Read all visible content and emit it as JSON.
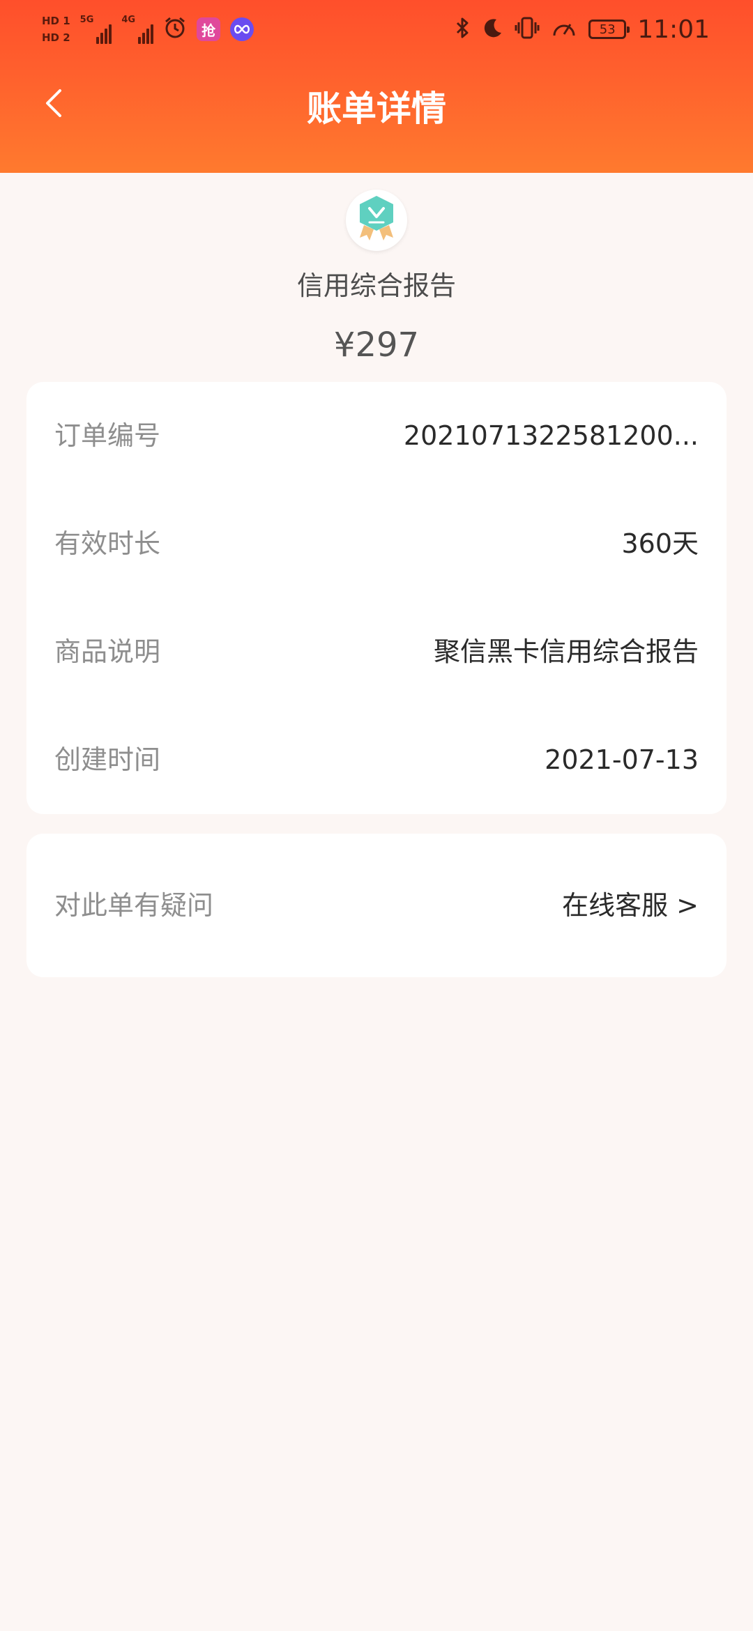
{
  "status_bar": {
    "hd1": "HD 1",
    "hd2": "HD 2",
    "net1": "5G",
    "net2": "4G",
    "app_badge_text": "抢",
    "battery": "53",
    "time": "11:01"
  },
  "header": {
    "title": "账单详情"
  },
  "product": {
    "name": "信用综合报告",
    "price": "¥297"
  },
  "details": [
    {
      "label": "订单编号",
      "value": "2021071322581200..."
    },
    {
      "label": "有效时长",
      "value": "360天"
    },
    {
      "label": "商品说明",
      "value": "聚信黑卡信用综合报告"
    },
    {
      "label": "创建时间",
      "value": "2021-07-13"
    }
  ],
  "support": {
    "label": "对此单有疑问",
    "link": "在线客服 >"
  },
  "colors": {
    "header_gradient_top": "#ff4f2b",
    "header_gradient_bottom": "#ff7a2e",
    "background": "#fcf6f4",
    "badge_teal": "#5fd0c0",
    "label_gray": "#8e8e8e",
    "value_dark": "#2a2a2a"
  },
  "icons": [
    "back-arrow-icon",
    "certificate-badge-icon",
    "bluetooth-icon",
    "moon-icon",
    "vibrate-icon",
    "speed-icon",
    "alarm-icon"
  ]
}
